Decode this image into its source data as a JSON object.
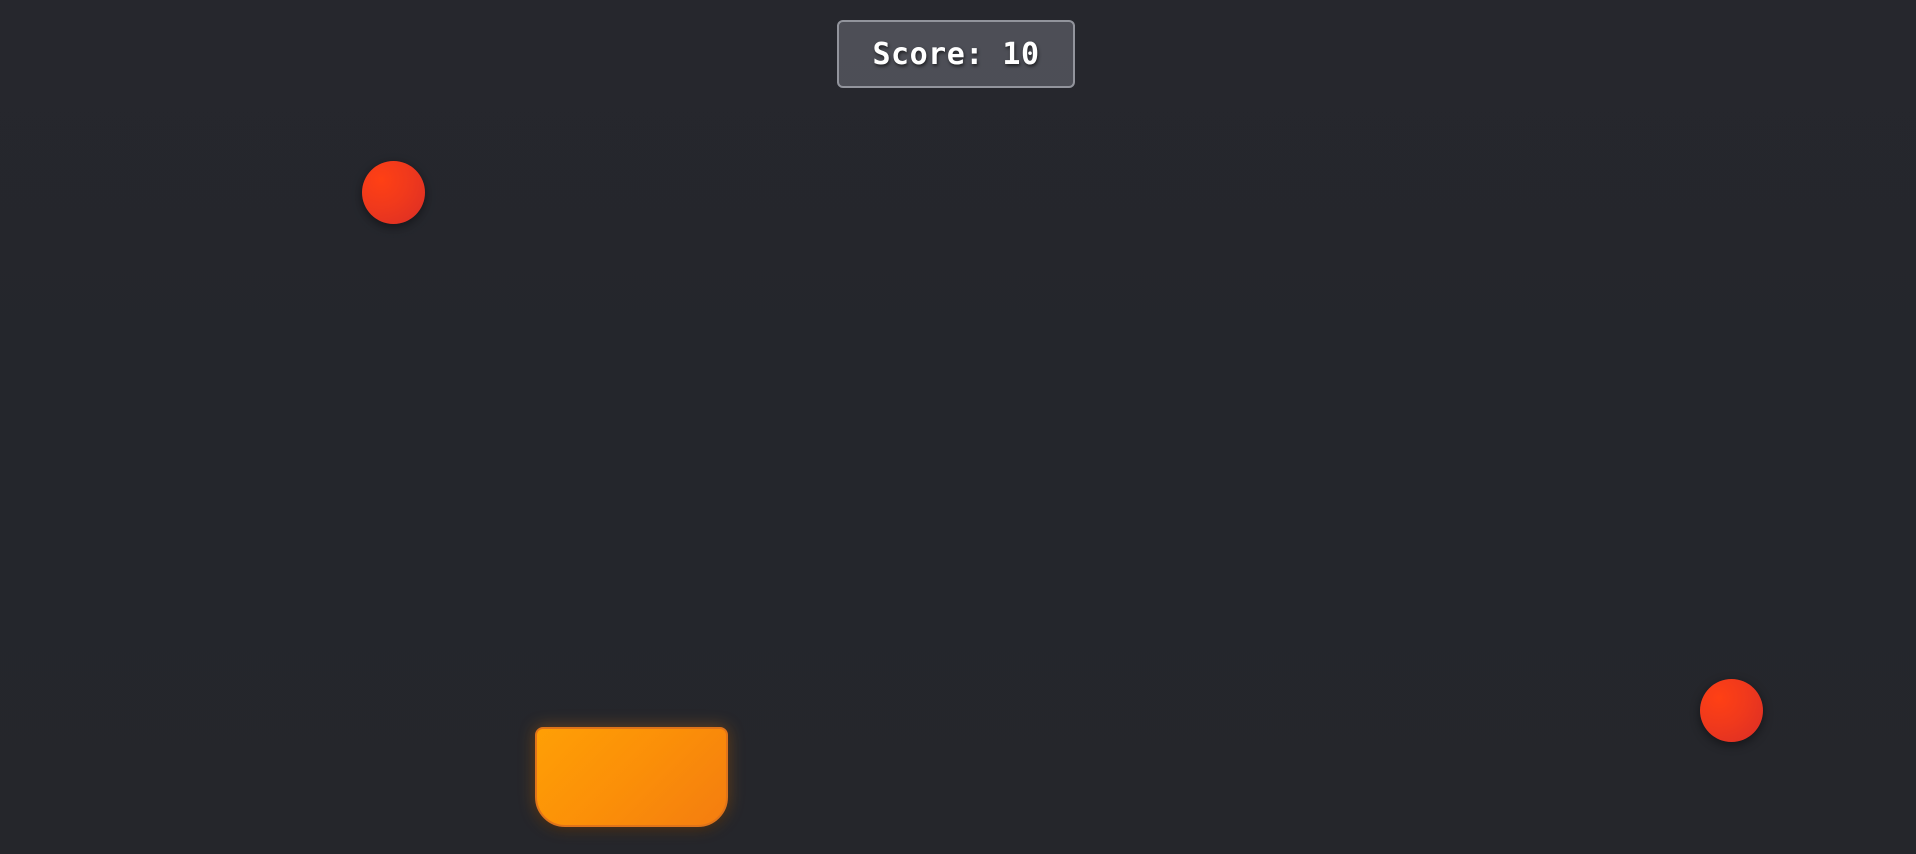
{
  "hud": {
    "score_text": "Score: 10",
    "score_value": 10
  },
  "objects": {
    "falling_balls_count": 2,
    "ball_color": "#f0391c",
    "paddle_color": "#fb8f08"
  },
  "colors": {
    "background": "#25262b",
    "score_panel": "#6e7078",
    "score_text": "#ffffff"
  }
}
